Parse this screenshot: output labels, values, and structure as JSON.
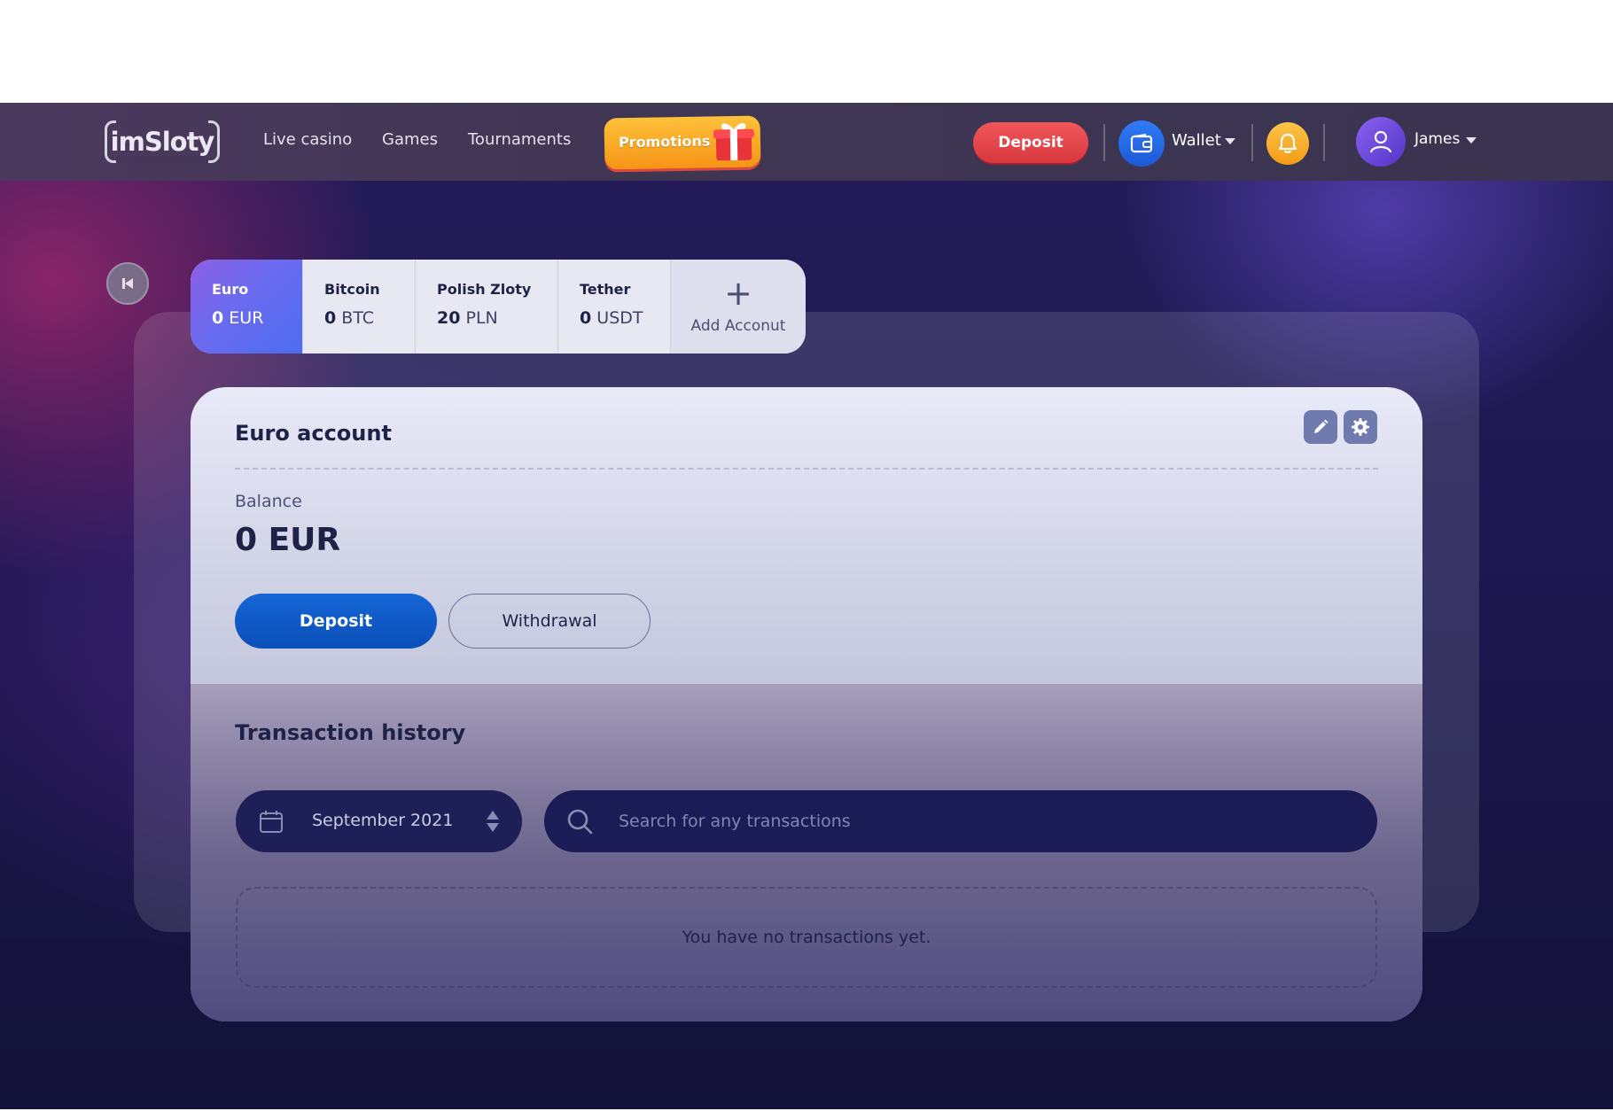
{
  "header": {
    "logo_text": "imSloty",
    "nav": [
      "Live casino",
      "Games",
      "Tournaments"
    ],
    "promotions_label": "Promotions",
    "deposit_label": "Deposit",
    "wallet_label": "Wallet",
    "user_name": "James"
  },
  "accounts": [
    {
      "name": "Euro",
      "amount": "0",
      "currency": "EUR",
      "active": true
    },
    {
      "name": "Bitcoin",
      "amount": "0",
      "currency": "BTC",
      "active": false
    },
    {
      "name": "Polish Zloty",
      "amount": "20",
      "currency": "PLN",
      "active": false
    },
    {
      "name": "Tether",
      "amount": "0",
      "currency": "USDT",
      "active": false
    }
  ],
  "add_account_label": "Add Acconut",
  "card": {
    "title": "Euro account",
    "balance_label": "Balance",
    "balance_value": "0 EUR",
    "deposit_label": "Deposit",
    "withdrawal_label": "Withdrawal"
  },
  "history": {
    "title": "Transaction history",
    "period": "September 2021",
    "search_placeholder": "Search for any transactions",
    "empty_text": "You have no transactions yet."
  },
  "colors": {
    "deposit_red": "#e04a4e",
    "deposit_blue": "#1062d4",
    "wallet_blue": "#2a6ef0",
    "bell_yellow": "#f7ae2c",
    "pill_navy": "#1d1e56"
  },
  "icons": [
    "back-icon",
    "gift-icon",
    "wallet-icon",
    "bell-icon",
    "user-icon",
    "pencil-icon",
    "gear-icon",
    "calendar-icon",
    "sort-arrows-icon",
    "search-icon",
    "plus-icon"
  ]
}
